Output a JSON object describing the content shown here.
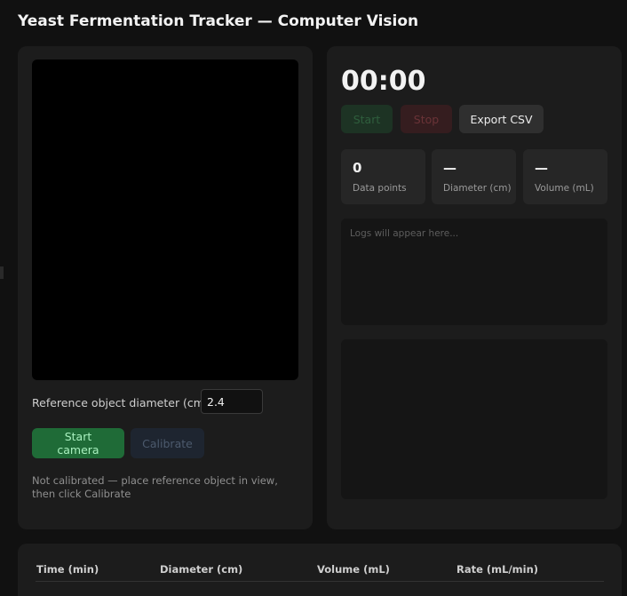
{
  "app": {
    "title": "Yeast Fermentation Tracker — Computer Vision"
  },
  "camera": {
    "reference_label": "Reference object diameter (cm):",
    "reference_value": "2.4",
    "start_camera_label": "Start camera",
    "calibrate_label": "Calibrate",
    "status": "Not calibrated — place reference object in view, then click Calibrate"
  },
  "controls": {
    "timer": "00:00",
    "start_label": "Start",
    "stop_label": "Stop",
    "export_label": "Export CSV"
  },
  "stats": [
    {
      "value": "0",
      "label": "Data points"
    },
    {
      "value": "—",
      "label": "Diameter (cm)"
    },
    {
      "value": "—",
      "label": "Volume (mL)"
    }
  ],
  "logs": {
    "placeholder": "Logs will appear here..."
  },
  "table": {
    "columns": [
      "Time (min)",
      "Diameter (cm)",
      "Volume (mL)",
      "Rate (mL/min)"
    ],
    "rows": []
  },
  "colors": {
    "background": "#111111",
    "panel": "#1c1c1c",
    "accent_green": "#1f6b37",
    "stop_red": "#351d1f"
  }
}
